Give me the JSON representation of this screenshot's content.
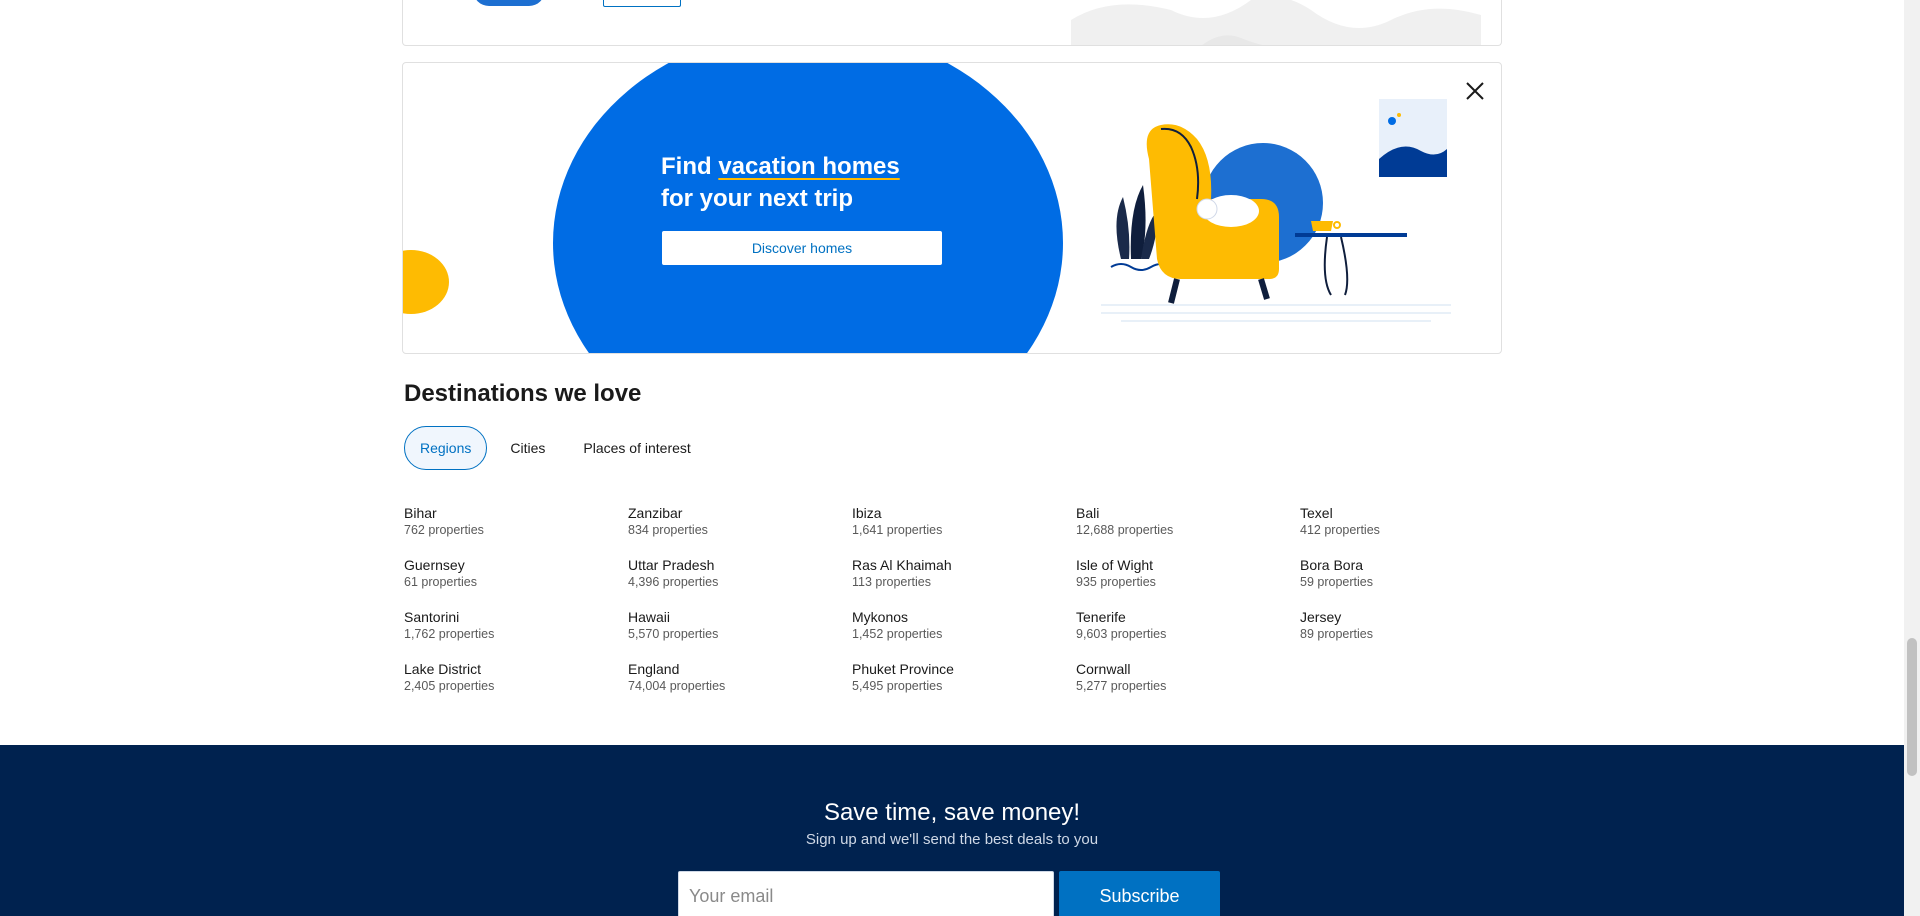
{
  "banner": {
    "headline_prefix": "Find ",
    "headline_highlight": "vacation homes",
    "headline_line2": "for your next trip",
    "cta_label": "Discover homes",
    "close_icon": "close-icon"
  },
  "destinations": {
    "title": "Destinations we love",
    "tabs": [
      {
        "label": "Regions",
        "active": true
      },
      {
        "label": "Cities",
        "active": false
      },
      {
        "label": "Places of interest",
        "active": false
      }
    ],
    "items": [
      {
        "name": "Bihar",
        "count": "762 properties"
      },
      {
        "name": "Zanzibar",
        "count": "834 properties"
      },
      {
        "name": "Ibiza",
        "count": "1,641 properties"
      },
      {
        "name": "Bali",
        "count": "12,688 properties"
      },
      {
        "name": "Texel",
        "count": "412 properties"
      },
      {
        "name": "Guernsey",
        "count": "61 properties"
      },
      {
        "name": "Uttar Pradesh",
        "count": "4,396 properties"
      },
      {
        "name": "Ras Al Khaimah",
        "count": "113 properties"
      },
      {
        "name": "Isle of Wight",
        "count": "935 properties"
      },
      {
        "name": "Bora Bora",
        "count": "59 properties"
      },
      {
        "name": "Santorini",
        "count": "1,762 properties"
      },
      {
        "name": "Hawaii",
        "count": "5,570 properties"
      },
      {
        "name": "Mykonos",
        "count": "1,452 properties"
      },
      {
        "name": "Tenerife",
        "count": "9,603 properties"
      },
      {
        "name": "Jersey",
        "count": "89 properties"
      },
      {
        "name": "Lake District",
        "count": "2,405 properties"
      },
      {
        "name": "England",
        "count": "74,004 properties"
      },
      {
        "name": "Phuket Province",
        "count": "5,495 properties"
      },
      {
        "name": "Cornwall",
        "count": "5,277 properties"
      }
    ]
  },
  "newsletter": {
    "title": "Save time, save money!",
    "subtitle": "Sign up and we'll send the best deals to you",
    "email_placeholder": "Your email",
    "email_value": "",
    "subscribe_label": "Subscribe"
  },
  "colors": {
    "brand_blue": "#006ce4",
    "link_blue": "#0071c2",
    "footer_navy": "#00224f",
    "accent_yellow": "#febb02"
  }
}
